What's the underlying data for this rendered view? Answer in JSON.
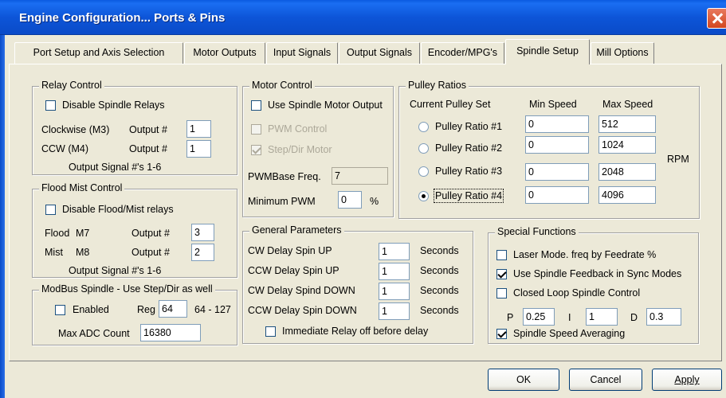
{
  "window": {
    "title": "Engine Configuration... Ports & Pins"
  },
  "tabs": [
    {
      "label": "Port Setup and Axis Selection"
    },
    {
      "label": "Motor Outputs"
    },
    {
      "label": "Input Signals"
    },
    {
      "label": "Output Signals"
    },
    {
      "label": "Encoder/MPG's"
    },
    {
      "label": "Spindle Setup"
    },
    {
      "label": "Mill Options"
    }
  ],
  "relay_control": {
    "title": "Relay Control",
    "disable_label": "Disable Spindle Relays",
    "cw_label": "Clockwise (M3)",
    "ccw_label": "CCW (M4)",
    "output_label": "Output #",
    "cw_output": "1",
    "ccw_output": "1",
    "footer": "Output Signal #'s 1-6"
  },
  "flood_mist": {
    "title": "Flood Mist Control",
    "disable_label": "Disable Flood/Mist relays",
    "flood_label": "Flood",
    "flood_code": "M7",
    "mist_label": "Mist",
    "mist_code": "M8",
    "output_label": "Output #",
    "flood_output": "3",
    "mist_output": "2",
    "footer": "Output Signal #'s 1-6"
  },
  "modbus": {
    "title": "ModBus Spindle - Use Step/Dir as well",
    "enabled_label": "Enabled",
    "reg_label": "Reg",
    "reg_value": "64",
    "reg_range": "64 - 127",
    "max_adc_label": "Max ADC Count",
    "max_adc_value": "16380"
  },
  "motor_control": {
    "title": "Motor Control",
    "use_spindle_label": "Use Spindle Motor Output",
    "pwm_label": "PWM Control",
    "stepdir_label": "Step/Dir Motor",
    "pwm_base_label": "PWMBase Freq.",
    "pwm_base_value": "7",
    "min_pwm_label": "Minimum PWM",
    "min_pwm_value": "0",
    "min_pwm_unit": "%"
  },
  "pulley": {
    "title": "Pulley Ratios",
    "current_label": "Current Pulley Set",
    "min_header": "Min Speed",
    "max_header": "Max Speed",
    "rpm_label": "RPM",
    "rows": [
      {
        "label": "Pulley Ratio #1",
        "min": "0",
        "max": "512"
      },
      {
        "label": "Pulley Ratio #2",
        "min": "0",
        "max": "1024"
      },
      {
        "label": "Pulley Ratio #3",
        "min": "0",
        "max": "2048"
      },
      {
        "label": "Pulley Ratio #4",
        "min": "0",
        "max": "4096"
      }
    ],
    "selected": 4
  },
  "general": {
    "title": "General Parameters",
    "unit": "Seconds",
    "rows": [
      {
        "label": "CW Delay Spin UP",
        "value": "1"
      },
      {
        "label": "CCW Delay Spin UP",
        "value": "1"
      },
      {
        "label": "CW Delay Spind DOWN",
        "value": "1"
      },
      {
        "label": "CCW Delay Spin DOWN",
        "value": "1"
      }
    ],
    "immediate_label": "Immediate Relay off before delay"
  },
  "special": {
    "title": "Special Functions",
    "laser_label": "Laser Mode. freq by Feedrate %",
    "feedback_label": "Use Spindle Feedback in Sync Modes",
    "closed_loop_label": "Closed Loop Spindle Control",
    "p_label": "P",
    "p_value": "0.25",
    "i_label": "I",
    "i_value": "1",
    "d_label": "D",
    "d_value": "0.3",
    "averaging_label": "Spindle Speed Averaging"
  },
  "buttons": {
    "ok": "OK",
    "cancel": "Cancel",
    "apply": "Apply"
  }
}
